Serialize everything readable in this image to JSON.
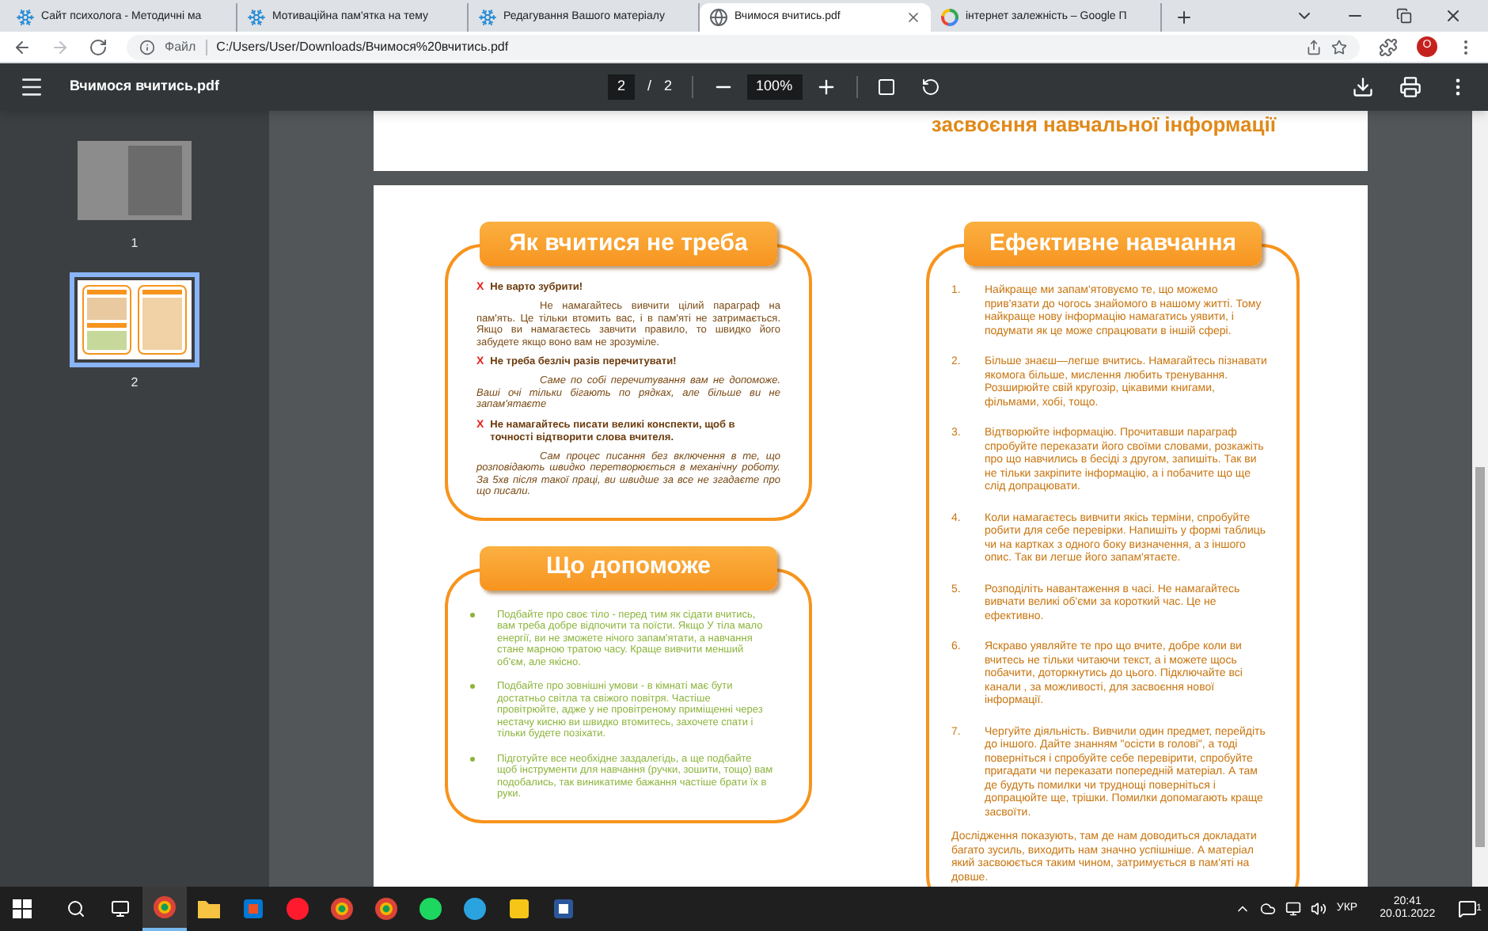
{
  "tabs": [
    {
      "title": "Сайт психолога - Методичні ма",
      "selected": false
    },
    {
      "title": "Мотиваційна пам'ятка на тему",
      "selected": false
    },
    {
      "title": "Редагування Вашого матеріалу",
      "selected": false
    },
    {
      "title": "Вчимося вчитись.pdf",
      "selected": true
    },
    {
      "title": "інтернет залежність – Google П",
      "selected": false
    }
  ],
  "address": {
    "scheme": "Файл",
    "url": "C:/Users/User/Downloads/Вчимося%20вчитись.pdf",
    "profile": "O"
  },
  "pdf_toolbar": {
    "title": "Вчимося вчитись.pdf",
    "page": "2",
    "separator": "/",
    "total": "2",
    "zoom": "100%"
  },
  "thumbnails": [
    {
      "label": "1",
      "kind": "photo",
      "selected": false
    },
    {
      "label": "2",
      "kind": "pages",
      "selected": true
    }
  ],
  "page_1": {
    "title_line": "засвоєння навчальної інформації"
  },
  "dont_section": {
    "heading": "Як вчитися не треба",
    "items": [
      {
        "marker": "X",
        "title": "Не варто зубрити!",
        "text": "Не намагайтесь вивчити цілий параграф на пам'ять. Це тільки втомить вас, і в пам'яті не затримається. Якщо ви намагаєтесь завчити правило, то швидко його забудете якщо воно вам не зрозуміле.",
        "italic": false
      },
      {
        "marker": "X",
        "title": "Не треба безліч разів перечитувати!",
        "text": "Саме по собі перечитування вам не допоможе. Ваші очі тільки бігають по рядках, але більше ви не запам'ятаєте",
        "italic": true
      },
      {
        "marker": "X",
        "title": "Не намагайтесь писати великі конспекти, щоб в точності відтворити слова вчителя.",
        "text": "Сам процес писання без включення в те, що розповідають швидко перетворюється в механічну роботу. За 5хв після такої праці, ви швидше за все не згадаєте про що писали.",
        "italic": true
      }
    ]
  },
  "help_section": {
    "heading": "Що допоможе",
    "items": [
      "Подбайте про своє тіло - перед тим як сідати вчитись, вам треба добре відпочити та поїсти. Якщо У тіла мало енергії, ви не зможете нічого запам'ятати, а навчання стане марною тратою часу. Краще вивчити менший об'єм, але якісно.",
      "Подбайте про зовнішні умови - в кімнаті має бути достатньо світла та свіжого повітря. Частіше провітрюйте, адже у не провітреному приміщенні через нестачу кисню ви швидко втомитесь, захочете спати і тільки будете позіхати.",
      "Підготуйте все необхідне заздалегідь, а ще подбайте щоб інструменти для навчання (ручки, зошити, тощо) вам подобались, так виникатиме бажання частіше брати їх в руки."
    ]
  },
  "effective_section": {
    "heading": "Ефективне навчання",
    "items": [
      {
        "number": "1.",
        "text": "Найкраще ми запам'ятовуємо те, що можемо прив'язати до чогось знайомого в нашому житті. Тому найкраще нову інформацію намагатись уявити, і подумати як це може спрацювати в іншій сфері."
      },
      {
        "number": "2.",
        "text": "Більше знаєш—легше вчитись. Намагайтесь пізнавати якомога більше, мислення любить тренування. Розширюйте свій кругозір, цікавими книгами, фільмами, хобі, тощо."
      },
      {
        "number": "3.",
        "text": "Відтворюйте інформацію. Прочитавши параграф спробуйте переказати його своїми словами, розкажіть про що навчились в бесіді з другом, запишіть. Так ви не тільки закріпите інформацію, а і побачите що ще слід допрацювати."
      },
      {
        "number": "4.",
        "text": "Коли намагаєтесь вивчити якісь терміни, спробуйте робити для себе перевірки. Напишіть у формі таблиць чи на картках з одного боку визначення, а з іншого опис. Так ви легше його запам'ятаєте."
      },
      {
        "number": "5.",
        "text": "Розподіліть навантаження в часі. Не намагайтесь вивчати великі об'єми за короткий час. Це не ефективно."
      },
      {
        "number": "6.",
        "text": "Яскраво уявляйте те про що вчите, добре коли ви вчитесь не тільки читаючи текст, а і можете щось побачити,  доторкнутись до цього. Підключайте всі канали , за можливості, для засвоєння нової інформації."
      },
      {
        "number": "7.",
        "text": "Чергуйте діяльність. Вивчили один предмет, перейдіть до іншого. Дайте знанням \"осісти в голові\", а тоді поверніться і спробуйте себе перевірити, спробуйте пригадати чи переказати попередній матеріал. А там де будуть помилки чи труднощі поверніться і допрацюйте ще, трішки. Помилки допомагають краще засвоїти."
      }
    ],
    "footer": "Дослідження показують, там де нам доводиться докладати багато зусиль, виходить нам значно успішніше. А матеріал який засвоюється таким чином, затримується в пам'яті на довше."
  },
  "taskbar": {
    "apps": [
      {
        "kind": "chrome",
        "selected": true
      },
      {
        "kind": "folder",
        "selected": false
      },
      {
        "kind": "store",
        "selected": false
      },
      {
        "kind": "opera",
        "selected": false
      },
      {
        "kind": "chrome",
        "selected": false
      },
      {
        "kind": "chrome",
        "selected": false
      },
      {
        "kind": "spotify",
        "selected": false
      },
      {
        "kind": "telegram",
        "selected": false
      },
      {
        "kind": "yellow",
        "selected": false
      },
      {
        "kind": "word",
        "selected": false
      }
    ],
    "language": "УКР",
    "time": "20:41",
    "date": "20.01.2022",
    "notifications": "1"
  }
}
